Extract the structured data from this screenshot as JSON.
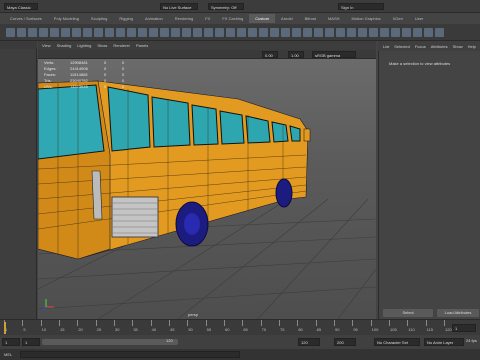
{
  "menu": {
    "workspace": "Maya Classic"
  },
  "shelf_tabs": [
    "Curves / Surfaces",
    "Poly Modeling",
    "Sculpting",
    "Rigging",
    "Animation",
    "Rendering",
    "FX",
    "FX Caching",
    "Custom",
    "Arnold",
    "Bifrost",
    "MASH",
    "Motion Graphics",
    "XGen",
    "User"
  ],
  "shelf_active": 8,
  "status_bar": {
    "no_live_surface": "No Live Surface",
    "symmetry": "Symmetry: Off",
    "sign_in": "Sign In"
  },
  "viewport_menu": [
    "View",
    "Shading",
    "Lighting",
    "Show",
    "Renderer",
    "Panels"
  ],
  "viewport_toolbar": {
    "value1": "0.00",
    "value2": "1.00",
    "color_space": "sRGB gamma"
  },
  "hud": {
    "rows": [
      {
        "label": "Verts:",
        "v1": "12908481",
        "v2": "0",
        "v3": "0"
      },
      {
        "label": "Edges:",
        "v1": "24414906",
        "v2": "0",
        "v3": "0"
      },
      {
        "label": "Faces:",
        "v1": "11514808",
        "v2": "0",
        "v3": "0"
      },
      {
        "label": "Tris:",
        "v1": "23040782",
        "v2": "0",
        "v3": "0"
      },
      {
        "label": "UVs:",
        "v1": "14573645",
        "v2": "0",
        "v3": "0"
      }
    ]
  },
  "camera_label": "persp",
  "right_panel": {
    "tabs": [
      "List",
      "Selected",
      "Focus",
      "Attributes",
      "Show",
      "Help"
    ],
    "message": "Make a selection to view attributes",
    "select_button": "Select",
    "load_button": "Load Attributes"
  },
  "timeline": {
    "ticks": [
      "1",
      "5",
      "10",
      "15",
      "20",
      "25",
      "30",
      "35",
      "40",
      "45",
      "50",
      "55",
      "60",
      "65",
      "70",
      "75",
      "80",
      "85",
      "90",
      "95",
      "100",
      "105",
      "110",
      "115",
      "120"
    ],
    "current_frame": "1"
  },
  "range": {
    "start": "1",
    "start2": "1",
    "end_inner": "120",
    "end_outer": "120",
    "end2": "200",
    "character_set": "No Character Set",
    "anim_layer": "No Anim Layer",
    "fps": "24 fps"
  },
  "command": {
    "label": "MEL"
  }
}
